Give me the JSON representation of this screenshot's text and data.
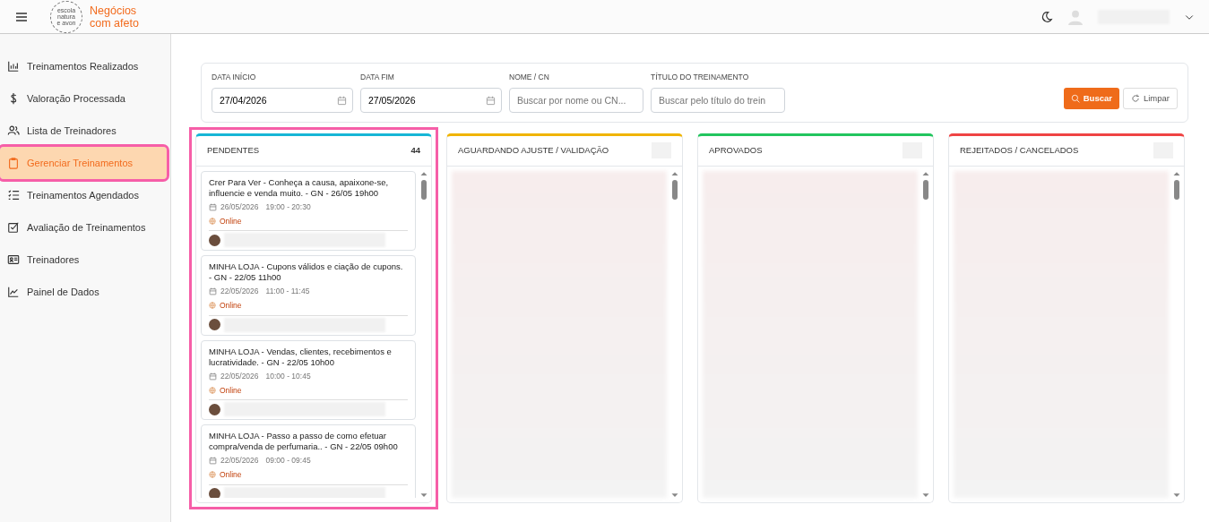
{
  "header": {
    "brand": [
      "Negócios",
      "com afeto"
    ],
    "logo_text": [
      "escola",
      "natura",
      "e avon"
    ]
  },
  "sidebar": {
    "items": [
      {
        "label": "Treinamentos Realizados",
        "selected": false,
        "highlighted": false
      },
      {
        "label": "Valoração Processada",
        "selected": false,
        "highlighted": false
      },
      {
        "label": "Lista de Treinadores",
        "selected": false,
        "highlighted": false
      },
      {
        "label": "Gerenciar Treinamentos",
        "selected": true,
        "highlighted": true
      },
      {
        "label": "Treinamentos Agendados",
        "selected": false,
        "highlighted": false
      },
      {
        "label": "Avaliação de Treinamentos",
        "selected": false,
        "highlighted": false
      },
      {
        "label": "Treinadores",
        "selected": false,
        "highlighted": false
      },
      {
        "label": "Painel de Dados",
        "selected": false,
        "highlighted": false
      }
    ]
  },
  "filters": {
    "fields": [
      {
        "label": "DATA INÍCIO",
        "value": "27/04/2026",
        "kind": "date"
      },
      {
        "label": "DATA FIM",
        "value": "27/05/2026",
        "kind": "date"
      },
      {
        "label": "NOME / CN",
        "placeholder": "Buscar por nome ou CN...",
        "kind": "text"
      },
      {
        "label": "TÍTULO DO TREINAMENTO",
        "placeholder": "Buscar pelo título do trein",
        "kind": "text"
      }
    ],
    "buttons": [
      {
        "label": "Buscar",
        "kind": "primary"
      },
      {
        "label": "Limpar",
        "kind": "secondary"
      }
    ]
  },
  "columns": [
    {
      "title": "PENDENTES",
      "count": "44",
      "color": "#17b6d6",
      "highlighted": true,
      "cards": [
        {
          "title": "Crer Para Ver - Conheça a causa, apaixone-se, influencie e venda muito. - GN - 26/05 19h00",
          "date": "26/05/2026",
          "time": "19:00 - 20:30",
          "location": "Online"
        },
        {
          "title": "MINHA LOJA - Cupons válidos e ciação de cupons. - GN - 22/05 11h00",
          "date": "22/05/2026",
          "time": "11:00 - 11:45",
          "location": "Online"
        },
        {
          "title": "MINHA LOJA - Vendas, clientes, recebimentos e lucratividade. - GN - 22/05 10h00",
          "date": "22/05/2026",
          "time": "10:00 - 10:45",
          "location": "Online"
        },
        {
          "title": "MINHA LOJA - Passo a passo de como efetuar compra/venda de perfumaria.. - GN - 22/05 09h00",
          "date": "22/05/2026",
          "time": "09:00 - 09:45",
          "location": "Online"
        }
      ]
    },
    {
      "title": "AGUARDANDO AJUSTE / VALIDAÇÃO",
      "color": "#f0b400",
      "highlighted": false
    },
    {
      "title": "APROVADOS",
      "color": "#22c55e",
      "highlighted": false
    },
    {
      "title": "REJEITADOS / CANCELADOS",
      "color": "#ef4444",
      "highlighted": false
    }
  ]
}
